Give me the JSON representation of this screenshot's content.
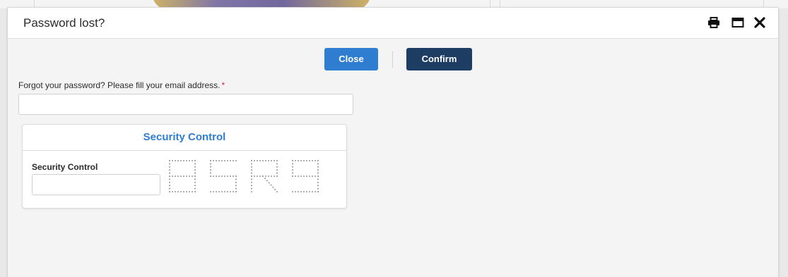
{
  "dialog": {
    "title": "Password lost?",
    "icons": {
      "print": "print-icon",
      "maximize": "maximize-icon",
      "close": "close-icon"
    }
  },
  "buttons": {
    "close_label": "Close",
    "confirm_label": "Confirm"
  },
  "email": {
    "label": "Forgot your password? Please fill your email address.",
    "required_marker": "*",
    "value": "",
    "placeholder": ""
  },
  "security": {
    "panel_title": "Security Control",
    "field_label": "Security Control",
    "value": "",
    "captcha_text": "8SR9"
  },
  "colors": {
    "primary_button": "#2e7dd1",
    "confirm_button": "#1d3d63",
    "panel_title": "#2e7dd1",
    "required": "#d12b2b"
  }
}
